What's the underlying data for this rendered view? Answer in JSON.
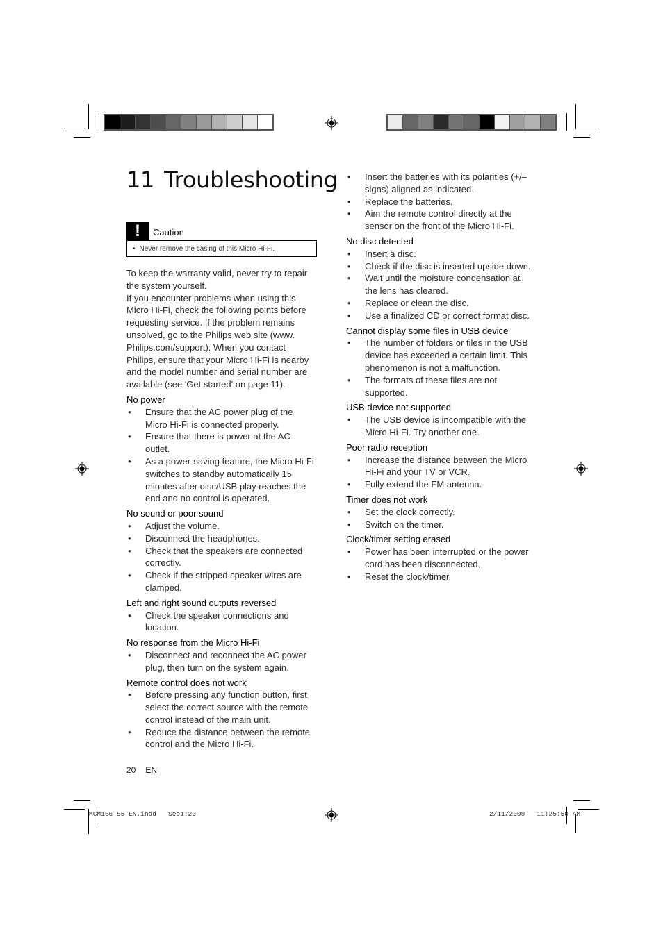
{
  "colorbars": {
    "left": [
      "#000000",
      "#1c1c1c",
      "#333333",
      "#4d4d4d",
      "#666666",
      "#808080",
      "#999999",
      "#b3b3b3",
      "#cccccc",
      "#e6e6e6",
      "#ffffff"
    ],
    "right": [
      "#ececec",
      "#666666",
      "#808080",
      "#2a2a2a",
      "#737373",
      "#666666",
      "#000000",
      "#f2f2f2",
      "#a0a0a0",
      "#b3b3b3",
      "#808080"
    ]
  },
  "title": {
    "number": "11",
    "text": "Troubleshooting"
  },
  "caution": {
    "icon": "exclamation-icon",
    "label": "Caution",
    "items": [
      "Never remove the casing of this Micro Hi-Fi."
    ]
  },
  "intro": [
    "To keep the warranty valid, never try to repair the system yourself.",
    "If you encounter problems when using this Micro Hi-Fi, check the following points before requesting service. If the problem remains unsolved, go to the Philips web site (www. Philips.com/support). When you contact Philips, ensure that your Micro Hi-Fi is nearby and the model number and serial number are available (see 'Get started' on page 11)."
  ],
  "sections": [
    {
      "title": "No power",
      "items": [
        "Ensure that the AC power plug of the Micro Hi-Fi is connected properly.",
        "Ensure that there is power at the AC outlet.",
        "As a power-saving feature, the Micro Hi-Fi switches to standby automatically 15 minutes after disc/USB play reaches the end and no control is operated."
      ]
    },
    {
      "title": "No sound or poor sound",
      "items": [
        "Adjust the volume.",
        "Disconnect the headphones.",
        "Check that the speakers are connected correctly.",
        "Check if the stripped speaker wires are clamped."
      ]
    },
    {
      "title": "Left and right sound outputs reversed",
      "items": [
        "Check the speaker connections and location."
      ]
    },
    {
      "title": "No response from the Micro Hi-Fi",
      "items": [
        "Disconnect and reconnect the AC power plug, then turn on the system again."
      ]
    },
    {
      "title": "Remote control does not work",
      "items": [
        "Before pressing any function button, first select the correct source with the remote control instead of the main unit.",
        "Reduce the distance between the remote control and the Micro Hi-Fi.",
        "Insert the batteries with its polarities (+/– signs) aligned as indicated.",
        "Replace the batteries.",
        "Aim the remote control directly at the sensor on the front of the Micro Hi-Fi."
      ]
    },
    {
      "title": "No disc detected",
      "items": [
        "Insert a disc.",
        "Check if the disc is inserted upside down.",
        "Wait until the moisture condensation at the lens has cleared.",
        "Replace or clean the disc.",
        "Use a finalized CD or correct format disc."
      ]
    },
    {
      "title": "Cannot display some files in USB device",
      "items": [
        "The number of folders or files in the USB device has exceeded a certain limit. This phenomenon is not a malfunction.",
        "The formats of these files are not supported."
      ]
    },
    {
      "title": "USB device not supported",
      "items": [
        "The USB device is incompatible with the Micro Hi-Fi. Try another one."
      ]
    },
    {
      "title": "Poor radio reception",
      "items": [
        "Increase the distance between the Micro Hi-Fi and your TV or VCR.",
        "Fully extend the FM antenna."
      ]
    },
    {
      "title": "Timer does not work",
      "items": [
        "Set the clock correctly.",
        "Switch on the timer."
      ]
    },
    {
      "title": "Clock/timer setting erased",
      "items": [
        "Power has been interrupted or the power cord has been disconnected.",
        "Reset the clock/timer."
      ]
    }
  ],
  "footer": {
    "page_number": "20",
    "language": "EN"
  },
  "slug": {
    "file": "MCM166_55_EN.indd   Sec1:20",
    "datetime": "2/11/2009   11:25:50 AM"
  },
  "bullet_char": "•"
}
